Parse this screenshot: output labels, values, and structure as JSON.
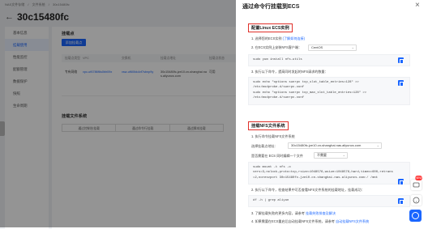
{
  "breadcrumb": [
    "NAS文件存储",
    "/",
    "文件系统",
    "/",
    "30c15480fc"
  ],
  "page": {
    "back_icon": "arrow-left-icon",
    "title": "30c15480fc"
  },
  "sidebar": {
    "items": [
      {
        "label": "基本信息",
        "active": false
      },
      {
        "label": "挂载使用",
        "active": true
      },
      {
        "label": "性能监控",
        "active": false
      },
      {
        "label": "配额管理",
        "active": false
      },
      {
        "label": "数据保护",
        "active": false
      },
      {
        "label": "快照",
        "active": false
      },
      {
        "label": "生命周期",
        "active": false
      }
    ]
  },
  "main": {
    "mount_section_title": "挂载点",
    "add_button": "添加挂载点",
    "table": {
      "headers": [
        "挂载点类型",
        "VPC",
        "交换机",
        "挂载点地址",
        "挂载点状态"
      ],
      "row": {
        "type": "专有网络",
        "vpc": "vpc-uf6786f6s0bh09x",
        "vswitch": "vsw-uf6l0kk4vf7sbnp9y",
        "address": "30c15480fc-jze10.cn-shanghai.nas.aliyuncs.com",
        "status": "可用"
      }
    },
    "mount_usage_title": "挂载文件系统",
    "usage_tabs": [
      "通过控制台挂载",
      "通过命令行挂载",
      "通过脚本挂载"
    ]
  },
  "drawer": {
    "title": "通过命令行挂载到ECS",
    "close_icon": "close-icon",
    "linux": {
      "title": "配置Linux ECS实例",
      "step1": "1. 选择您的ECS实例",
      "step1_link": "(了解如何连接)",
      "step2": "2. 在ECS实例上安装NFS客户端：",
      "os_select": "CentOS",
      "install_cmd": "sudo yum install nfs-utils",
      "step3": "3. 执行以下命令，提高同时发起的NFS请求的数量：",
      "sysctl_cmd": [
        "sudo echo \"options sunrpc tcp_slot_table_entries=128\" >>",
        "/etc/modprobe.d/sunrpc.conf",
        "sudo echo \"options sunrpc tcp_max_slot_table_entries=128\" >>",
        "/etc/modprobe.d/sunrpc.conf"
      ]
    },
    "mount": {
      "title": "挂载NFS文件系统",
      "step1": "1. 执行命令挂载NFS文件系统",
      "addr_label": "选择挂载点地址:",
      "addr_value": "30c15480fc-jze10.cn-shanghai.nas.aliyuncs.com",
      "dir_label": "是否需要在 ECS 同时编辑一个文件",
      "dir_value": "不需要",
      "mount_cmd": [
        "sudo mount -t nfs -o",
        "vers=3,nolock,proto=tcp,rsize=1048576,wsize=1048576,hard,timeo=600,retrans",
        "=2,noresvport 30c15480fc-jze10.cn-shanghai.nas.aliyuncs.com:/ /mnt"
      ],
      "step2": "2. 执行以下命令，检查结果中可否查看NFS文件系统的挂载地址，挂载成功：",
      "check_cmd": "df -h | grep aliyun",
      "step3": "3. 了解挂载失败的更多内容，请参考",
      "step3_link": "挂载失败排查及解决",
      "step4": "4. 如果需要在ECS重启后自动挂载NFS文件系统，请参考",
      "step4_link": "自动挂载NFS文件系统"
    }
  },
  "floating": {
    "badge": "NEW",
    "icons": [
      "message-icon",
      "help-icon",
      "chat-icon"
    ]
  },
  "colors": {
    "accent": "#1a66ff",
    "highlight": "#e0302a"
  }
}
